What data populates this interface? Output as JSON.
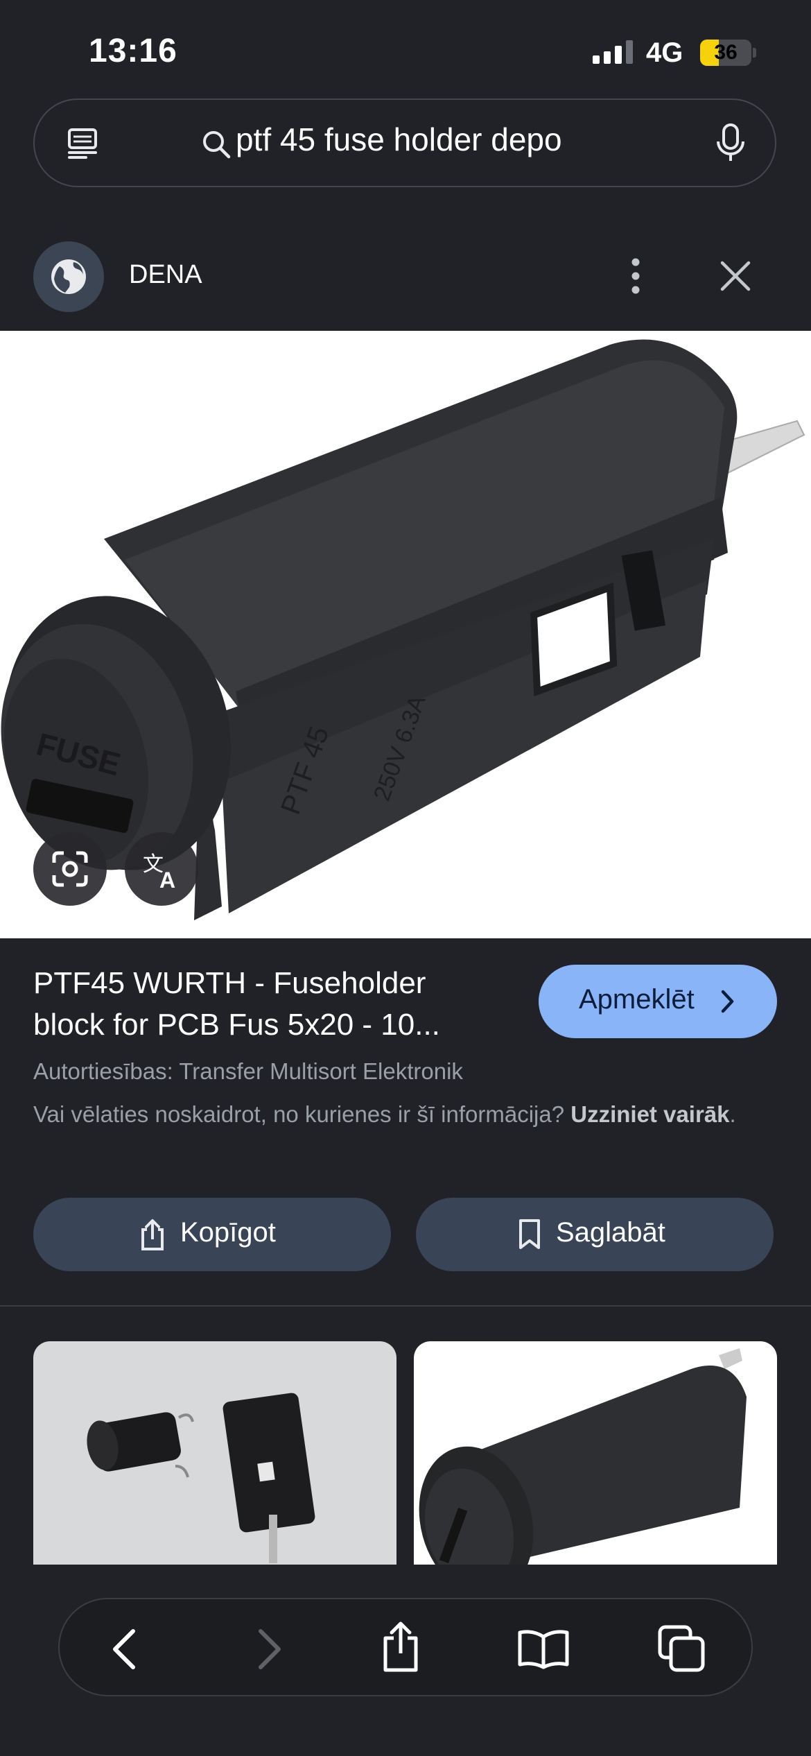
{
  "status_bar": {
    "time": "13:16",
    "network": "4G",
    "battery": "36",
    "battery_fraction": 0.36
  },
  "search": {
    "query": "ptf 45 fuse holder depo"
  },
  "source": {
    "name": "DENA"
  },
  "result": {
    "title_line1": "PTF45 WURTH - Fuseholder",
    "title_line2": "block for PCB Fus 5x20 - 10...",
    "visit_label": "Apmeklēt",
    "copyright": "Autortiesības: Transfer Multisort Elektronik",
    "question_text": "Vai vēlaties noskaidrot, no kurienes ir šī informācija? ",
    "learn_more": "Uzziniet vairāk",
    "question_end": "."
  },
  "actions": {
    "share_label": "Kopīgot",
    "save_label": "Saglabāt"
  },
  "colors": {
    "background": "#202227",
    "accent": "#8ab4f8",
    "button_bg": "#394457",
    "battery": "#f5d20a"
  },
  "icons": [
    "tabs-icon",
    "search-icon",
    "mic-icon",
    "globe-icon",
    "more-vert-icon",
    "close-icon",
    "lens-icon",
    "translate-icon",
    "chevron-right-icon",
    "share-icon",
    "bookmark-icon",
    "back-icon",
    "forward-icon",
    "book-icon",
    "tabs-overview-icon"
  ]
}
